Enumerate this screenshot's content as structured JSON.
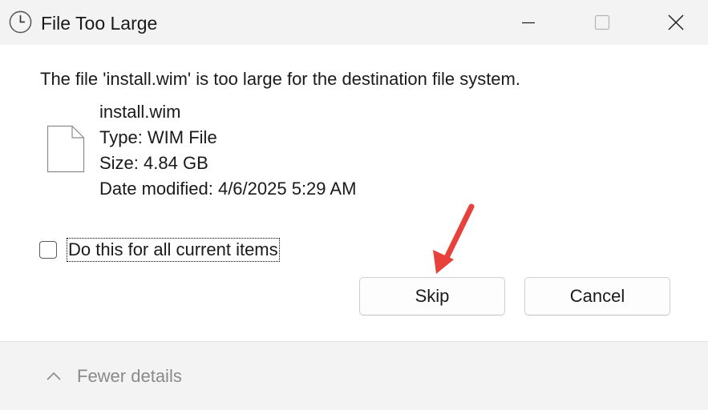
{
  "window": {
    "title": "File Too Large",
    "title_icon": "clock-icon",
    "controls": [
      "minimize-icon",
      "maximize-icon",
      "close-icon"
    ]
  },
  "message": "The file 'install.wim' is too large for the destination file system.",
  "file": {
    "icon": "document-icon",
    "name": "install.wim",
    "type": "Type: WIM File",
    "size": "Size: 4.84 GB",
    "date_modified": "Date modified: 4/6/2025 5:29 AM"
  },
  "apply_all": {
    "label": "Do this for all current items",
    "checked": false
  },
  "buttons": {
    "skip": "Skip",
    "cancel": "Cancel"
  },
  "footer": {
    "details_label": "Fewer details",
    "details_icon": "chevron-up-icon"
  },
  "colors": {
    "titlebar_bg": "#f3f3f3",
    "footer_bg": "#f3f3f3",
    "annotation_arrow": "#e8413c"
  }
}
